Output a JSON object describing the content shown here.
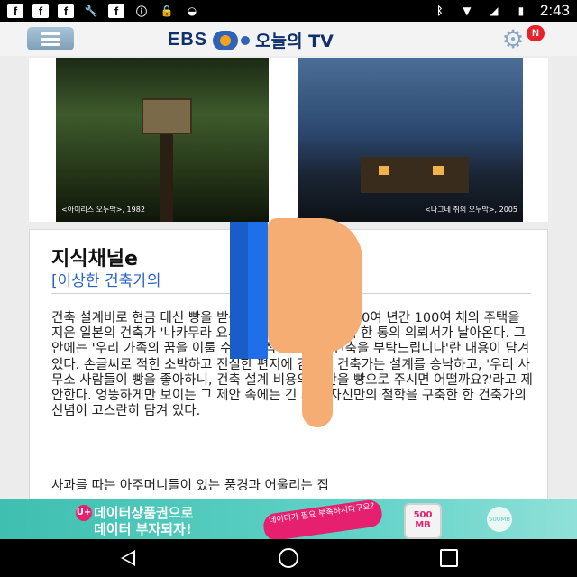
{
  "status_bar": {
    "left_icons": [
      "facebook-icon",
      "facebook-icon",
      "facebook-icon",
      "wrench-icon",
      "facebook-icon",
      "alert-icon",
      "lock-icon",
      "android-icon"
    ],
    "right_icons": [
      "bluetooth-icon",
      "wifi-icon",
      "signal-icon",
      "battery-icon"
    ],
    "time": "2:43"
  },
  "header": {
    "logo_brand": "EBS",
    "logo_title": "오늘의 TV",
    "notification_badge": "N",
    "icons": {
      "menu": "menu-icon",
      "settings": "gear-icon"
    }
  },
  "photos": [
    {
      "caption": "<아이리스 오두막>, 1982"
    },
    {
      "caption": "<나그네 쥐의 오두막>, 2005"
    }
  ],
  "article": {
    "title": "지식채널e",
    "subtitle": "[이상한 건축가의",
    "body": "건축 설계비로 현금 대신 빵을 받은 이상한 건축가 지난 30여 년간 100여 채의 주택을 지은 일본의 건축가 '나카무라 요시후미', 어느 날 그에게 한 통의 의뢰서가 날아온다. 그 안에는 '우리 가족의 꿈을 이룰 수 있는 작은 빵집의 건축을 부탁드립니다'란 내용이 담겨 있다. 손글씨로 적힌 소박하고 진실한 편지에 감동한 건축가는 설계를 승낙하고, '우리 사무소 사람들이 빵을 좋아하니, 건축 설계 비용의 절반을 빵으로 주시면 어떨까요?'라고 제안한다. 엉뚱하게만 보이는 그 제안 속에는 긴 세월 자신만의 철학을 구축한 한 건축가의 신념이 고스란히 담겨 있다.",
    "body_next": "사과를 따는 아주머니들이 있는 풍경과 어울리는 집"
  },
  "ad": {
    "logo": "U+",
    "line1": "데이터상품권으로",
    "line2": "데이터 부자되자!",
    "bubble": "데이터가 필요 부족하시다구요?",
    "phone_text": "500 MB",
    "coin_text": "500MB"
  },
  "nav": {
    "icons": [
      "back-icon",
      "home-icon",
      "recent-apps-icon"
    ]
  },
  "colors": {
    "accent_blue": "#2a63c4",
    "brand_navy": "#10306b",
    "badge_red": "#e4232b",
    "ad_teal": "#3fbfb0"
  }
}
